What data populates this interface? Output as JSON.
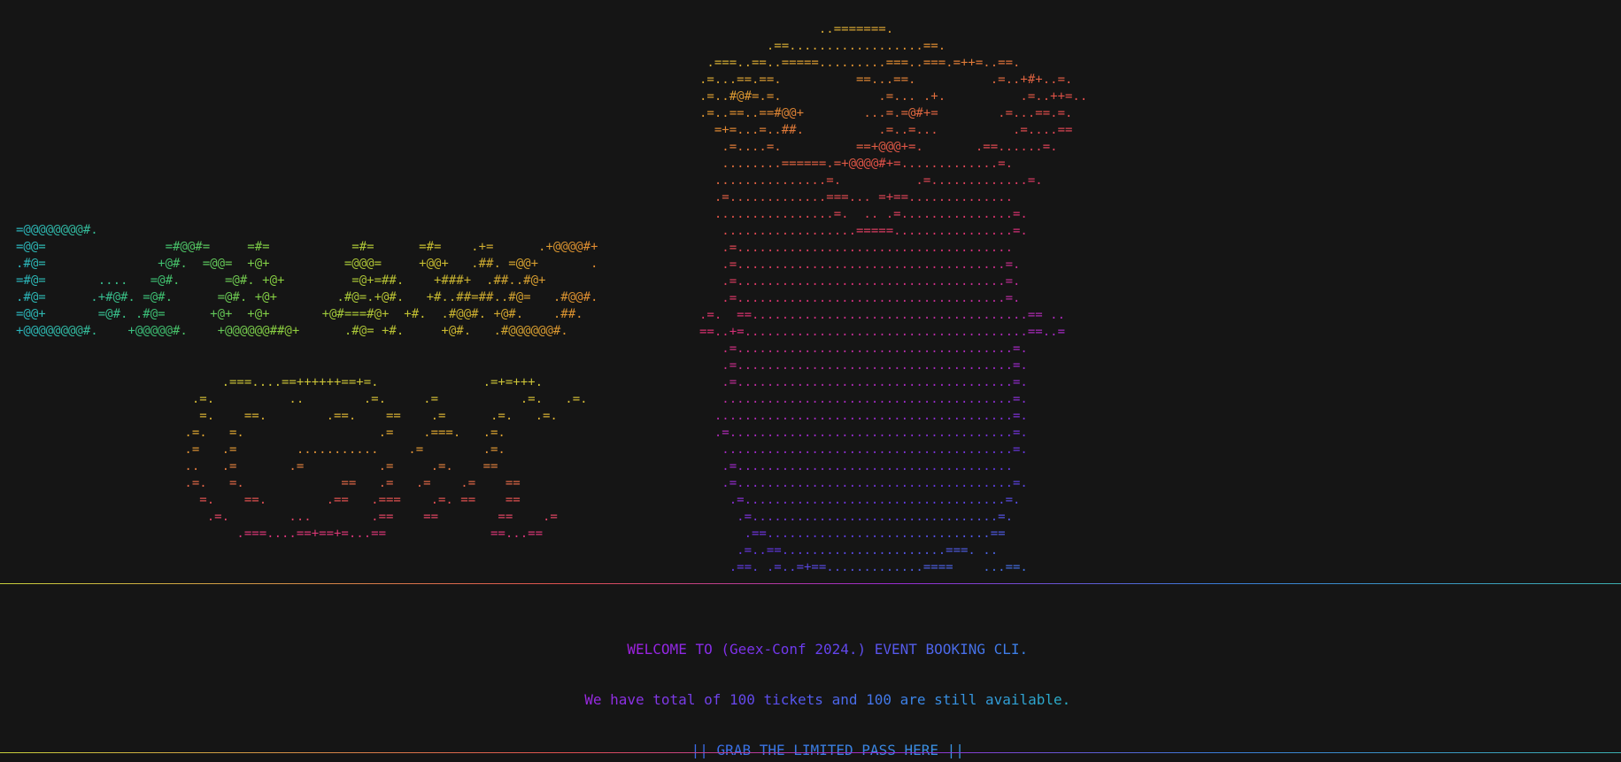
{
  "terminal": {
    "logo_art": "=@@@@@@@@#.\n=@@=                =#@@#=     =#=           =#=      =#=    .+=      .+@@@@#+\n.#@=               +@#.  =@@=  +@+          =@@@=     +@@+   .##. =@@+       .\n=#@=       ....   =@#.      =@#. +@+         =@+=##.    +###+  .##..#@+\n.#@=      .+#@#. =@#.      =@#. +@+        .#@=.+@#.   +#..##=##..#@=   .#@@#.\n=@@+       =@#. .#@=      +@+  +@+       +@#===#@+  +#.  .#@@#. +@#.    .##.\n+@@@@@@@@#.    +@@@@@#.    +@@@@@@##@+      .#@= +#.     +@#.   .#@@@@@@#.",
    "geex_art": "      .===....==++++++==+=.              .=+=+++.\n  .=.          ..        .=.     .=           .=.   .=.\n   =.    ==.        .==.    ==    .=      .=.   .=.\n .=.   =.                  .=    .===.   .=.\n .=   .=        ...........    .=        .=.\n ..   .=       .=          .=     .=.    ==\n .=.   =.             ==   .=   .=    .=    ==\n   =.    ==.        .==   .===    .=. ==    ==\n    .=.        ...        .==    ==        ==    .=\n        .===....==+==+=...==              ==...==",
    "pumpkin_art": "                ..=======.\n         .==..................==.\n .===..==..=====.........===..===.=++=..==.\n.=...==.==.          ==...==.          .=..+#+..=.\n.=..#@#=.=.             .=... .+.          .=..++=..\n.=..==..==#@@+        ...=.=@#+=        .=...==.=.\n  =+=...=..##.          .=..=...          .=....==\n   .=....=.          ==+@@@+=.       .==......=.\n   ........======.=+@@@@#+=.............=.\n  ...............=.          .=.............=.\n  .=.............===... =+==..............\n  ................=.  .. .=...............=.\n   ..................=====................=.\n   .=.....................................\n   .=....................................=.\n   .=....................................=.\n   .=....................................=.\n.=.  ==.....................................== ..\n==..+=......................................==..=\n   .=.....................................=.\n   .=.....................................=.\n   .=.....................................=.\n   .......................................=.\n  ........................................=.\n  .=......................................=.\n   .......................................=.\n   .=.....................................\n   .=.....................................=.\n    .=...................................=.\n     .=.................................=.\n      .==..............................==\n     .=..==......................===. ..\n    .==. .=..=+==.............====    ...==.",
    "welcome_text": "WELCOME TO (Geex-Conf 2024.) EVENT BOOKING CLI.",
    "tickets_text": "We have total of 100 tickets and 100 are still available.",
    "grab_text": "|| GRAB THE LIMITED PASS HERE ||",
    "colors": {
      "background": "#151515",
      "accent_purple": "#a020e0",
      "accent_blue": "#3a84e8",
      "accent_cyan": "#2ab0c8"
    }
  }
}
